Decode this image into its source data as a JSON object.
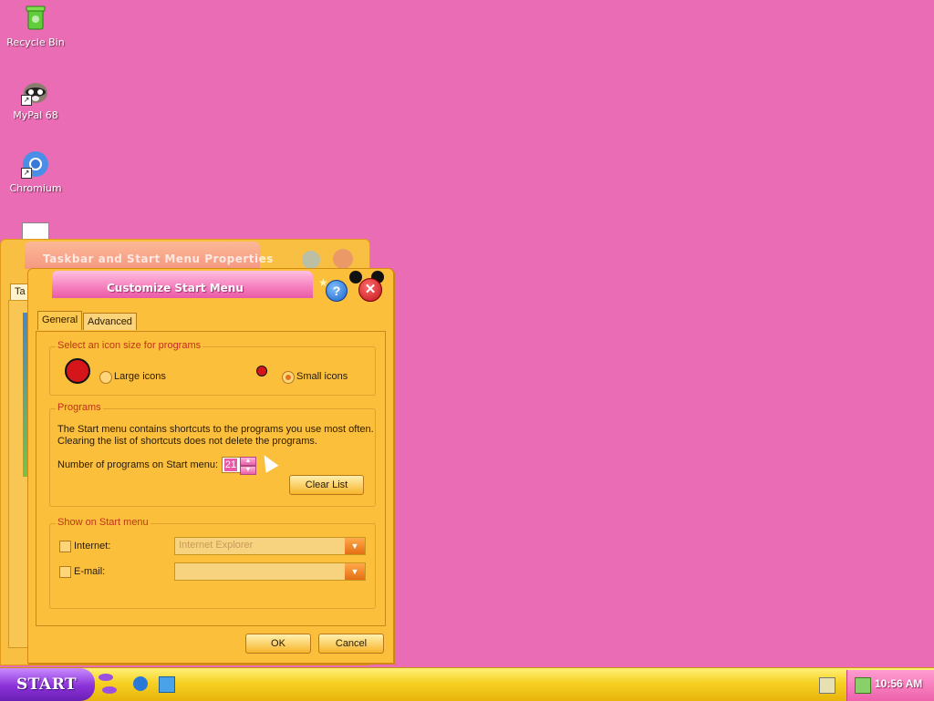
{
  "desktop": {
    "icons": [
      {
        "label": "Recycle Bin",
        "icon": "recycle-bin-icon"
      },
      {
        "label": "MyPal 68",
        "icon": "raccoon-icon"
      },
      {
        "label": "Chromium",
        "icon": "chromium-icon"
      }
    ]
  },
  "back_window": {
    "title": "Taskbar and Start Menu Properties",
    "tab_label": "Ta"
  },
  "dialog": {
    "title": "Customize Start Menu",
    "help_label": "?",
    "close_label": "✕",
    "tabs": [
      {
        "label": "General",
        "active": true
      },
      {
        "label": "Advanced",
        "active": false
      }
    ],
    "icon_size": {
      "title": "Select an icon size for programs",
      "large_label": "Large icons",
      "small_label": "Small icons",
      "selected": "Small icons"
    },
    "programs": {
      "title": "Programs",
      "description_line1": "The Start menu contains shortcuts to the programs you use most often.",
      "description_line2": "Clearing the list of shortcuts does not delete the programs.",
      "count_label": "Number of programs on Start menu:",
      "count_value": "21",
      "clear_button": "Clear List"
    },
    "show_on_start": {
      "title": "Show on Start menu",
      "internet_label": "Internet:",
      "internet_value": "Internet Explorer",
      "email_label": "E-mail:",
      "email_value": ""
    },
    "ok_button": "OK",
    "cancel_button": "Cancel"
  },
  "taskbar": {
    "start_label": "START",
    "clock": "10:56 AM"
  },
  "colors": {
    "desktop": "#e96cb4",
    "dialog": "#fbbf3c",
    "accent_pink": "#f57ebd",
    "group_title": "#c2321b"
  }
}
